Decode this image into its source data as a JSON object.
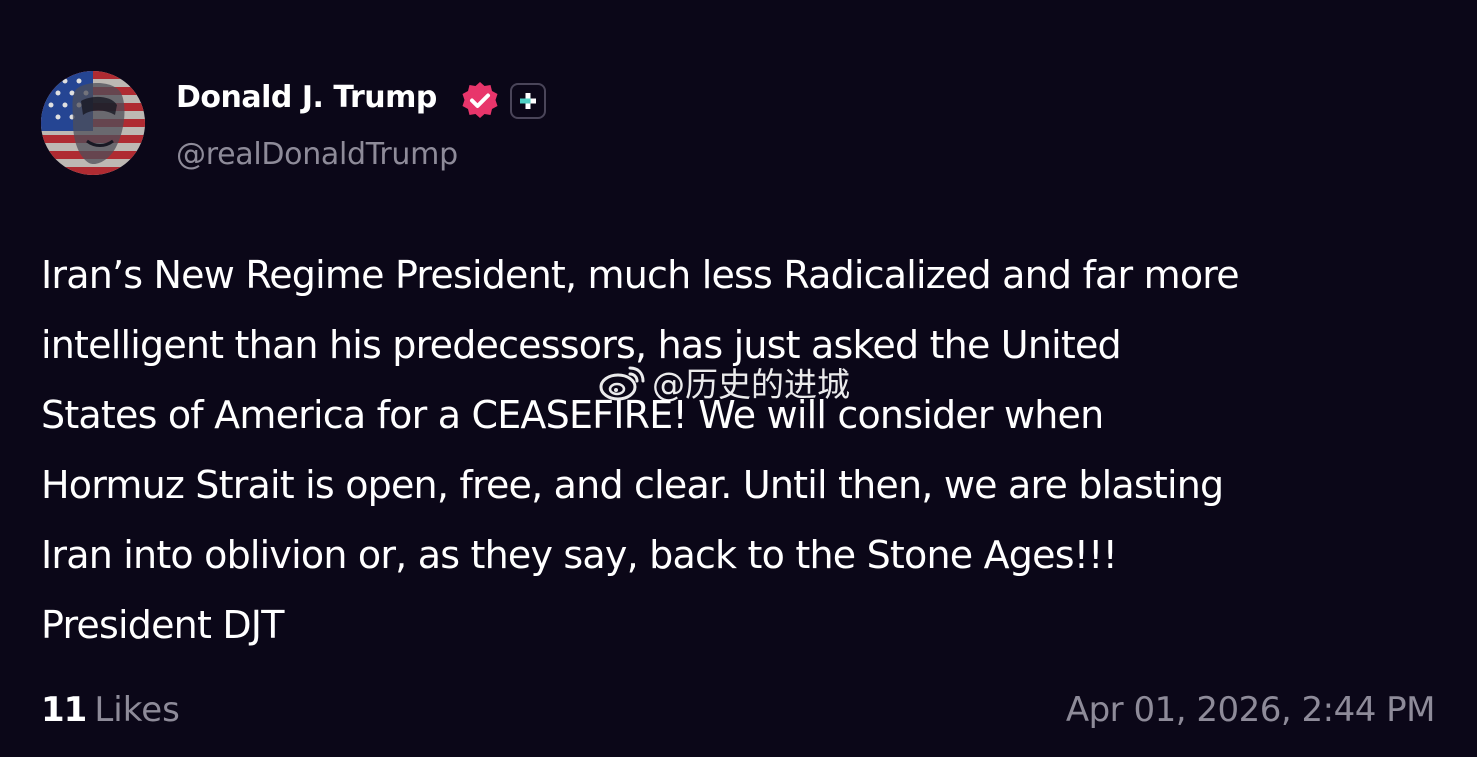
{
  "author": {
    "display_name": "Donald J. Trump",
    "handle": "@realDonaldTrump",
    "avatar": "avatar-flag-portrait",
    "verified_icon": "verified-badge-icon",
    "verified_color": "#e8356b",
    "plus_icon": "plus-badge-icon",
    "plus_color": "#4fd1c5"
  },
  "post": {
    "lines": [
      "Iran’s New Regime President, much less Radicalized and far more",
      "intelligent than his predecessors, has just asked the United",
      "States of America for a CEASEFIRE! We will consider when",
      "Hormuz Strait is open, free, and clear. Until then, we are blasting",
      "Iran into oblivion or, as they say, back to the Stone Ages!!!",
      "President DJT"
    ]
  },
  "footer": {
    "likes_count": "11",
    "likes_label": "Likes",
    "timestamp": "Apr 01, 2026, 2:44 PM"
  },
  "watermark": {
    "icon": "weibo-icon",
    "text": "@历史的进城"
  },
  "colors": {
    "background": "#0b0718",
    "text": "#ffffff",
    "muted": "#8e8b99"
  }
}
